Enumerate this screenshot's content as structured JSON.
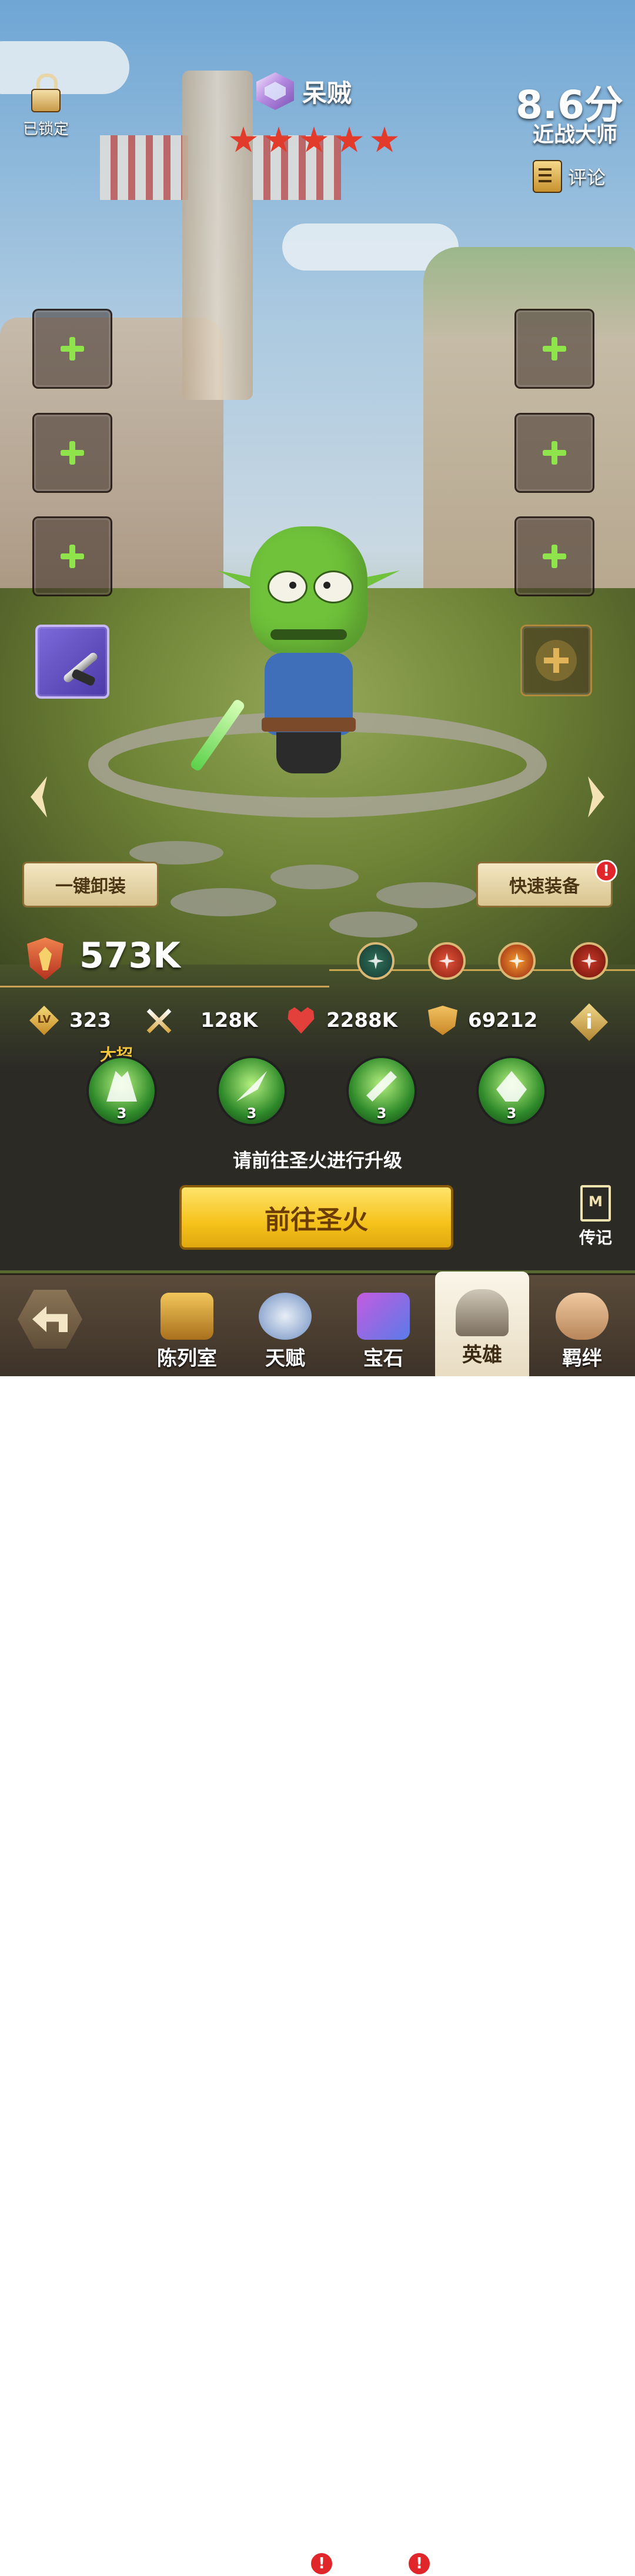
{
  "header": {
    "lock_label": "已锁定",
    "hero_name": "呆贼",
    "stars": 5,
    "score": "8.6分",
    "rank_title": "近战大师",
    "comment_label": "评论"
  },
  "actions": {
    "unequip_all": "一键卸装",
    "quick_equip": "快速装备",
    "quick_equip_badge": "!"
  },
  "power": {
    "value": "573K"
  },
  "stats": {
    "level_icon_text": "LV",
    "level": "323",
    "attack": "128K",
    "hp": "2288K",
    "defense": "69212",
    "info_icon_text": "i"
  },
  "skills": {
    "ultimate_label": "大招",
    "items": [
      {
        "name": "ultimate-skill",
        "level": "3"
      },
      {
        "name": "skill-2",
        "level": "3"
      },
      {
        "name": "skill-3",
        "level": "3"
      },
      {
        "name": "skill-4",
        "level": "3"
      }
    ]
  },
  "upgrade": {
    "hint": "请前往圣火进行升级",
    "button": "前往圣火"
  },
  "biography": {
    "icon_text": "M",
    "label": "传记"
  },
  "nav": {
    "tabs": [
      {
        "label": "陈列室",
        "badge": ""
      },
      {
        "label": "天赋",
        "badge": "!"
      },
      {
        "label": "宝石",
        "badge": "!"
      },
      {
        "label": "英雄",
        "badge": ""
      },
      {
        "label": "羁绊",
        "badge": ""
      }
    ]
  },
  "colors": {
    "star": "#e23b2b",
    "plus": "#8fe34b",
    "primary_button": "#f5c21a",
    "badge": "#e0262a"
  }
}
